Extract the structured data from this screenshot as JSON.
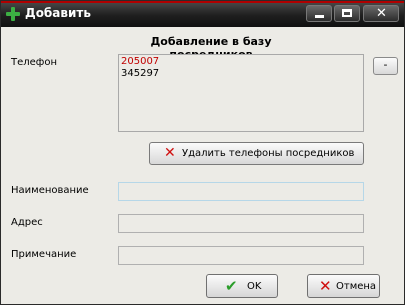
{
  "window": {
    "title": "Добавить"
  },
  "dialog": {
    "header": "Добавление в базу посредников",
    "phone_label": "Телефон",
    "phones": [
      "205007",
      "345297"
    ],
    "phone_colors": [
      "#c00000",
      "#000000"
    ],
    "dash_button": "-",
    "delete_button": "Удалить телефоны посредников",
    "name_label": "Наименование",
    "address_label": "Адрес",
    "note_label": "Примечание",
    "name_value": "",
    "address_value": "",
    "note_value": ""
  },
  "buttons": {
    "ok": "OK",
    "cancel": "Отмена"
  },
  "icons": {
    "app": "add-icon",
    "ok": "checkmark-icon",
    "cancel": "cross-icon",
    "delete": "cross-icon"
  },
  "colors": {
    "title_bar": "#1f1f1f",
    "dialog_bg": "#ecebe6",
    "phone_highlight": "#c00000"
  }
}
